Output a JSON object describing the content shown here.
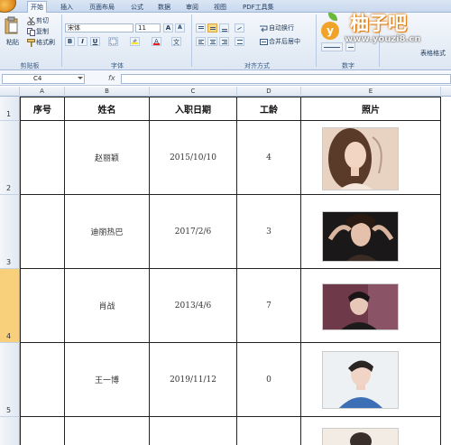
{
  "ribbon": {
    "tabs": [
      "开始",
      "插入",
      "页面布局",
      "公式",
      "数据",
      "审阅",
      "视图",
      "PDF工具集"
    ],
    "clipboard": {
      "paste": "粘贴",
      "cut": "剪切",
      "copy": "复制",
      "format_painter": "格式刷",
      "label": "剪贴板"
    },
    "font": {
      "name": "宋体",
      "size": "11",
      "bold": "B",
      "italic": "I",
      "underline": "U",
      "label": "字体"
    },
    "alignment": {
      "wrap": "自动换行",
      "merge": "合并后居中",
      "label": "对齐方式"
    },
    "number": {
      "label": "数字"
    },
    "styles": {
      "table_format": "表格格式"
    }
  },
  "watermark": {
    "brand": "柚子吧",
    "badge": "y",
    "url": "www.youzi8.cn"
  },
  "formula_bar": {
    "cell_ref": "C4",
    "fx": "fx",
    "value": ""
  },
  "grid": {
    "columns": [
      "A",
      "B",
      "C",
      "D",
      "E"
    ],
    "rows": [
      "1",
      "2",
      "3",
      "4",
      "5"
    ],
    "selected_row": "4"
  },
  "table": {
    "headers": [
      "序号",
      "姓名",
      "入职日期",
      "工龄",
      "照片"
    ],
    "rows": [
      {
        "seq": "",
        "name": "赵丽颖",
        "date": "2015/10/10",
        "years": "4",
        "photo": "portrait-woman-light"
      },
      {
        "seq": "",
        "name": "迪丽热巴",
        "date": "2017/2/6",
        "years": "3",
        "photo": "portrait-woman-dark"
      },
      {
        "seq": "",
        "name": "肖战",
        "date": "2013/4/6",
        "years": "7",
        "photo": "portrait-man-dark"
      },
      {
        "seq": "",
        "name": "王一博",
        "date": "2019/11/12",
        "years": "0",
        "photo": "portrait-man-blue"
      }
    ]
  },
  "colors": {
    "selected_row": "#f8cf7a",
    "ribbon": "#dde7f3",
    "watermark": "#f0a328"
  }
}
